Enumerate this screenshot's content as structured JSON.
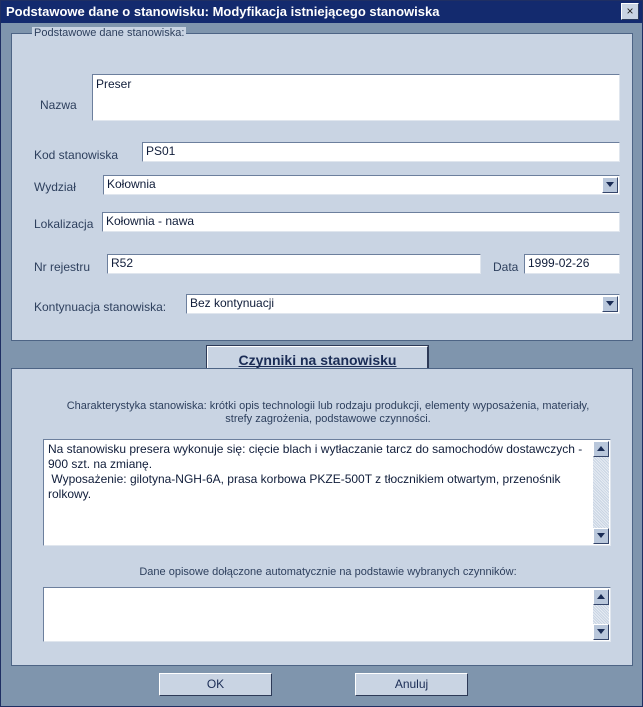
{
  "window": {
    "title": "Podstawowe dane o stanowisku: Modyfikacja istniejącego stanowiska",
    "close_glyph": "×"
  },
  "basic": {
    "legend": "Podstawowe dane stanowiska:",
    "name_label": "Nazwa",
    "name_value": "Preser",
    "code_label": "Kod stanowiska",
    "code_value": "PS01",
    "department_label": "Wydział",
    "department_value": "Kołownia",
    "location_label": "Lokalizacja",
    "location_value": "Kołownia - nawa",
    "registry_label": "Nr rejestru",
    "registry_value": "R52",
    "date_label": "Data",
    "date_value": "1999-02-26",
    "continuation_label": "Kontynuacja stanowiska:",
    "continuation_value": "Bez kontynuacji"
  },
  "factors_button": "Czynniki na stanowisku",
  "characteristics": {
    "prompt": "Charakterystyka  stanowiska: krótki opis technologii lub rodzaju produkcji, elementy wyposażenia, materiały, strefy zagrożenia, podstawowe czynności.",
    "text": "Na stanowisku presera wykonuje się: cięcie blach i wytłaczanie tarcz do samochodów dostawczych - 900 szt. na zmianę.\n Wyposażenie: gilotyna-NGH-6A, prasa korbowa PKZE-500T z tłocznikiem otwartym, przenośnik rolkowy."
  },
  "auto_description": {
    "label": "Dane opisowe dołączone automatycznie na podstawie wybranych czynników:",
    "text": ""
  },
  "buttons": {
    "ok": "OK",
    "cancel": "Anuluj"
  },
  "icons": {
    "close": "close-icon",
    "dropdown": "chevron-down-icon",
    "scroll_up": "arrow-up-icon",
    "scroll_down": "arrow-down-icon"
  },
  "colors": {
    "title_bar": "#132a6e",
    "panel": "#c9d4e3",
    "background": "#7f95ad"
  }
}
